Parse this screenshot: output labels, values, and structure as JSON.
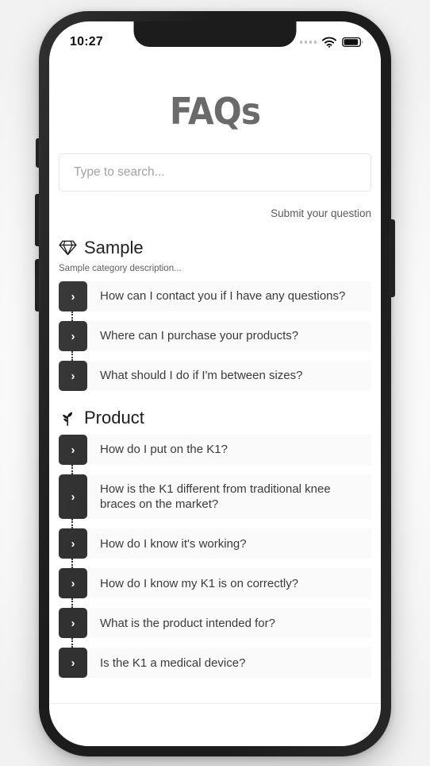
{
  "status_bar": {
    "time": "10:27",
    "signal_icon": "signal-dots-icon",
    "wifi_icon": "wifi-icon",
    "battery_icon": "battery-icon"
  },
  "header": {
    "title": "FAQs"
  },
  "search": {
    "value": "",
    "placeholder": "Type to search...",
    "icon": "search-input"
  },
  "submit": {
    "label": "Submit your question"
  },
  "categories": [
    {
      "name": "Sample",
      "icon": "diamond-icon",
      "description": "Sample category description...",
      "questions": [
        {
          "text": "How can I contact you if I have any questions?",
          "toggle": "›"
        },
        {
          "text": "Where can I purchase your products?",
          "toggle": "›"
        },
        {
          "text": "What should I do if I'm between sizes?",
          "toggle": "›"
        }
      ]
    },
    {
      "name": "Product",
      "icon": "seedling-icon",
      "description": "",
      "questions": [
        {
          "text": "How do I put on the K1?",
          "toggle": "›"
        },
        {
          "text": "How is the K1 different from traditional knee braces on the market?",
          "toggle": "›"
        },
        {
          "text": "How do I know it's working?",
          "toggle": "›"
        },
        {
          "text": "How do I know my K1 is on correctly?",
          "toggle": "›"
        },
        {
          "text": "What is the product intended for?",
          "toggle": "›"
        },
        {
          "text": "Is the K1 a medical device?",
          "toggle": "›"
        }
      ]
    }
  ],
  "colors": {
    "device_frame": "#1c1c1c",
    "title_gray": "#6a6a6a",
    "toggle_dark": "#313131",
    "row_background": "#fafafa",
    "text_primary": "#3a3a3a",
    "placeholder": "#9e9e9e"
  }
}
